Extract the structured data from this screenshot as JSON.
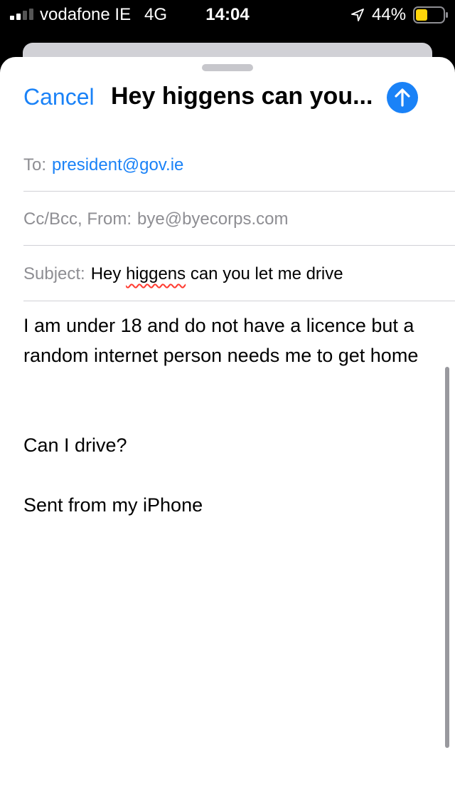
{
  "status_bar": {
    "carrier": "vodafone IE",
    "network": "4G",
    "time": "14:04",
    "battery_percent": "44%",
    "battery_level": 0.44,
    "icons": [
      "signal-icon",
      "location-arrow-icon",
      "battery-icon"
    ]
  },
  "compose": {
    "cancel_label": "Cancel",
    "title": "Hey higgens can you...",
    "send_icon": "arrow-up-icon",
    "to_label": "To:",
    "to_value": "president@gov.ie",
    "cc_label": "Cc/Bcc, From:",
    "from_value": "bye@byecorps.com",
    "subject_label": "Subject:",
    "subject_pre": "Hey",
    "subject_misspelled": "higgens",
    "subject_post": "can you let me drive",
    "body_line1": "I am under 18 and do not have a licence but a random internet person needs me to get home",
    "body_line2": "Can I drive?",
    "signature": "Sent from my iPhone"
  },
  "colors": {
    "accent": "#1a82f7",
    "label_gray": "#8e8e93",
    "spellcheck": "#ff3b30"
  }
}
